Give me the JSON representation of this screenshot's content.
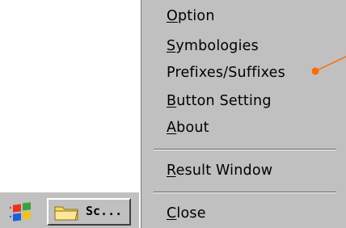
{
  "menu": {
    "items": [
      {
        "mnemonic": "O",
        "rest": "ption"
      },
      {
        "mnemonic": "S",
        "rest": "ymbologies"
      },
      {
        "mnemonic": "",
        "rest": "Prefixes/Suffixes"
      },
      {
        "mnemonic": "B",
        "rest": "utton Setting"
      },
      {
        "mnemonic": "A",
        "rest": "bout"
      },
      {
        "mnemonic": "R",
        "rest": "esult Window"
      },
      {
        "mnemonic": "C",
        "rest": "lose"
      }
    ]
  },
  "taskbar": {
    "task_button_label": "Sc..."
  },
  "colors": {
    "menu_background": "#c0c0c0",
    "callout": "#ff6a00"
  },
  "icons": {
    "start": "windows-flag-icon",
    "task": "folder-icon"
  }
}
